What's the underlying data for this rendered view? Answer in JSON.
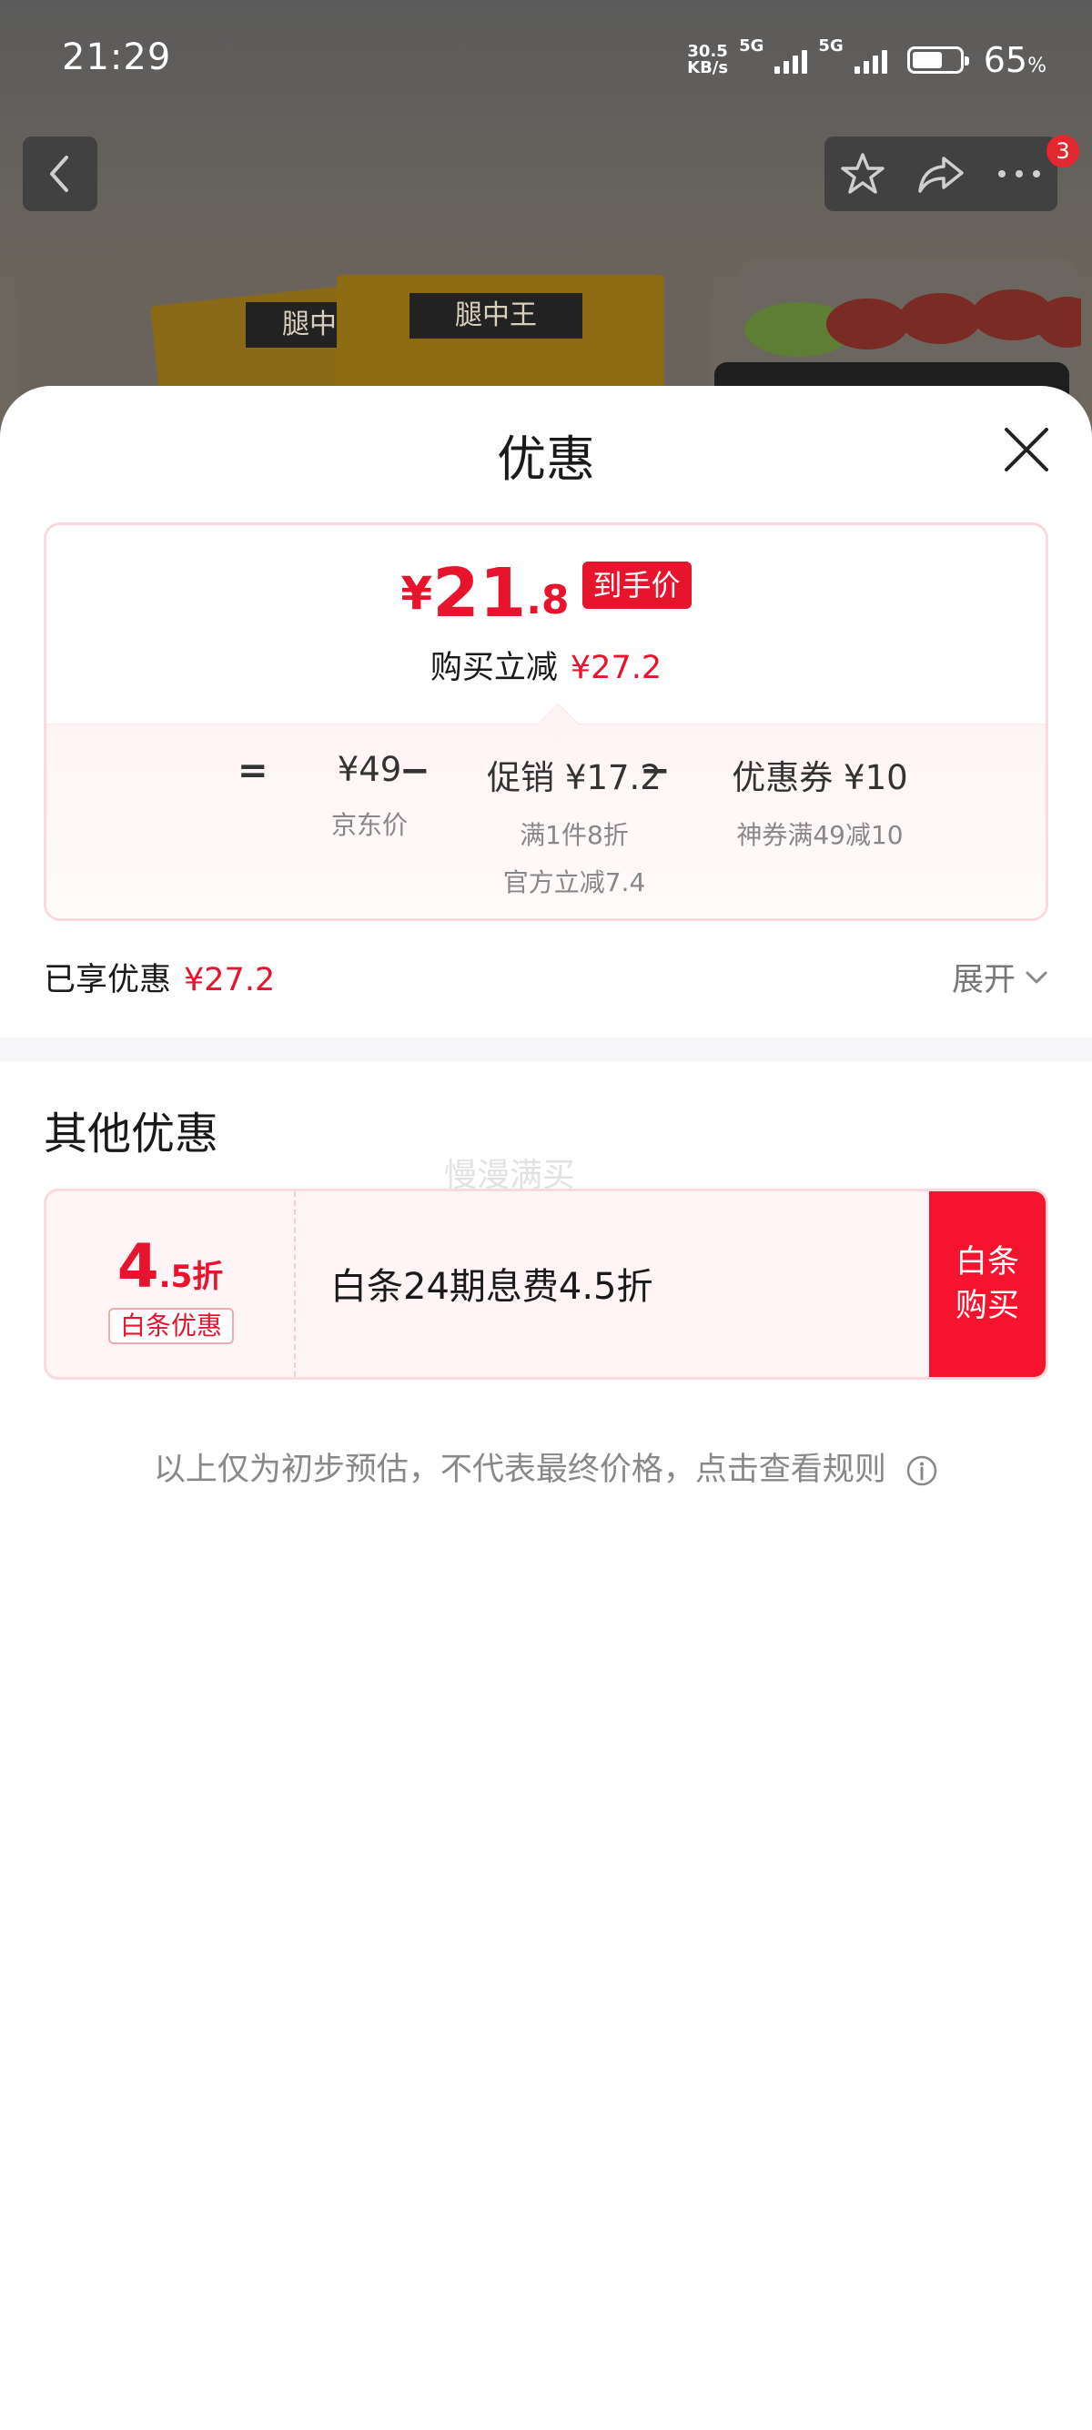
{
  "status_bar": {
    "time": "21:29",
    "net_speed_value": "30.5",
    "net_speed_unit": "KB/s",
    "sim1_label": "5G",
    "sim2_label": "5G",
    "battery_percent": "65",
    "battery_unit": "%"
  },
  "background_page": {
    "cart_badge_count": "3",
    "product_label_1": "腿中",
    "product_label_2": "腿中王"
  },
  "sheet": {
    "title": "优惠",
    "final_price": {
      "currency": "¥",
      "integer": "21",
      "decimal": ".8",
      "tag": "到手价"
    },
    "saving_label": "购买立减",
    "saving_value": "¥27.2",
    "breakdown": {
      "equals": "=",
      "minus": "−",
      "jd_price": "¥49",
      "jd_price_label": "京东价",
      "promo_title": "促销 ¥17.2",
      "promo_detail_1": "满1件8折",
      "promo_detail_2": "官方立减7.4",
      "coupon_title": "优惠券 ¥10",
      "coupon_detail": "神券满49减10"
    },
    "enjoyed_label": "已享优惠",
    "enjoyed_value": "¥27.2",
    "expand_label": "展开",
    "other_title": "其他优惠",
    "watermark": "慢漫满买",
    "baitiao": {
      "discount_big": "4",
      "discount_small": ".5折",
      "tag": "白条优惠",
      "description": "白条24期息费4.5折",
      "button_line1": "白条",
      "button_line2": "购买"
    },
    "disclaimer": "以上仅为初步预估，不代表最终价格，点击查看规则"
  },
  "colors": {
    "accent_red": "#e8132c",
    "button_red": "#f5132e",
    "pink_border": "#fbd9de"
  },
  "icons": [
    "back-icon",
    "star-icon",
    "share-icon",
    "more-icon",
    "close-icon",
    "chevron-down-icon",
    "info-icon"
  ]
}
